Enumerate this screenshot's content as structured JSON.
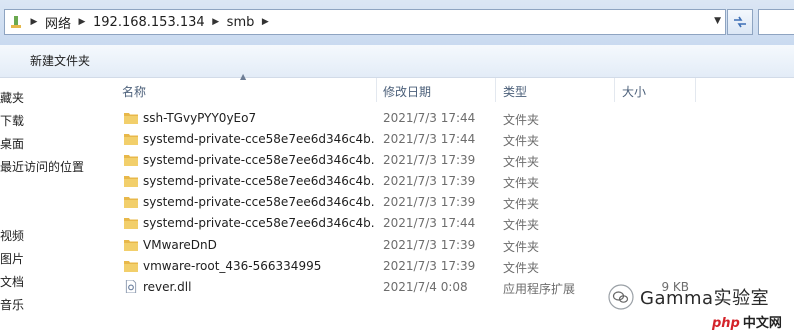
{
  "address": {
    "crumbs": [
      "网络",
      "192.168.153.134",
      "smb"
    ]
  },
  "toolbar": {
    "new_folder": "新建文件夹"
  },
  "nav": {
    "items": [
      "藏夹",
      "下载",
      "桌面",
      "最近访问的位置",
      "视频",
      "图片",
      "文档",
      "音乐"
    ]
  },
  "columns": {
    "name": "名称",
    "modified": "修改日期",
    "type": "类型",
    "size": "大小"
  },
  "files": [
    {
      "name": "ssh-TGvyPYY0yEo7",
      "date": "2021/7/3 17:44",
      "type": "文件夹",
      "size": "",
      "icon": "folder-icon"
    },
    {
      "name": "systemd-private-cce58e7ee6d346c4b...",
      "date": "2021/7/3 17:44",
      "type": "文件夹",
      "size": "",
      "icon": "folder-icon"
    },
    {
      "name": "systemd-private-cce58e7ee6d346c4b...",
      "date": "2021/7/3 17:39",
      "type": "文件夹",
      "size": "",
      "icon": "folder-icon"
    },
    {
      "name": "systemd-private-cce58e7ee6d346c4b...",
      "date": "2021/7/3 17:39",
      "type": "文件夹",
      "size": "",
      "icon": "folder-icon"
    },
    {
      "name": "systemd-private-cce58e7ee6d346c4b...",
      "date": "2021/7/3 17:39",
      "type": "文件夹",
      "size": "",
      "icon": "folder-icon"
    },
    {
      "name": "systemd-private-cce58e7ee6d346c4b...",
      "date": "2021/7/3 17:44",
      "type": "文件夹",
      "size": "",
      "icon": "folder-icon"
    },
    {
      "name": "VMwareDnD",
      "date": "2021/7/3 17:39",
      "type": "文件夹",
      "size": "",
      "icon": "folder-icon"
    },
    {
      "name": "vmware-root_436-566334995",
      "date": "2021/7/3 17:39",
      "type": "文件夹",
      "size": "",
      "icon": "folder-icon"
    },
    {
      "name": "rever.dll",
      "date": "2021/7/4 0:08",
      "type": "应用程序扩展",
      "size": "9 KB",
      "icon": "dll-file-icon"
    }
  ],
  "watermark": {
    "text": "Gamma实验室",
    "site_a": "php",
    "site_b": "中文网"
  },
  "colors": {
    "folder": "#e8b84a",
    "folder_dark": "#c9962a",
    "header_text": "#4c607a"
  }
}
